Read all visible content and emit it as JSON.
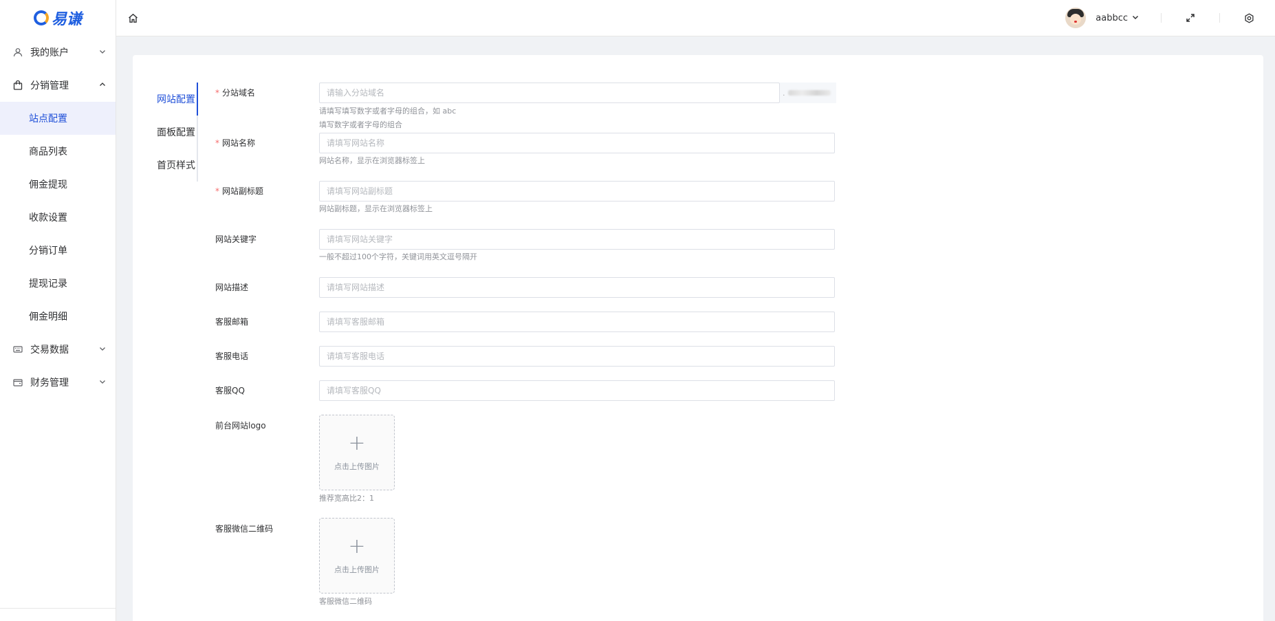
{
  "brand": {
    "name": "易谦"
  },
  "sidebar": {
    "groups": [
      {
        "label": "我的账户",
        "icon": "user-icon",
        "expanded": false
      },
      {
        "label": "分销管理",
        "icon": "bag-icon",
        "expanded": true,
        "items": [
          {
            "label": "站点配置",
            "active": true
          },
          {
            "label": "商品列表"
          },
          {
            "label": "佣金提现"
          },
          {
            "label": "收款设置"
          },
          {
            "label": "分销订单"
          },
          {
            "label": "提现记录"
          },
          {
            "label": "佣金明细"
          }
        ]
      },
      {
        "label": "交易数据",
        "icon": "keyboard-icon",
        "expanded": false
      },
      {
        "label": "财务管理",
        "icon": "wallet-icon",
        "expanded": false
      }
    ]
  },
  "header": {
    "username": "aabbcc"
  },
  "tabs": [
    {
      "label": "网站配置",
      "active": true
    },
    {
      "label": "面板配置"
    },
    {
      "label": "首页样式"
    }
  ],
  "form": {
    "domain": {
      "label": "分站域名",
      "required": true,
      "placeholder": "请输入分站域名",
      "suffix": ".",
      "hint1": "请填写填写数字或者字母的组合，如 abc",
      "hint2": "填写数字或者字母的组合"
    },
    "site_name": {
      "label": "网站名称",
      "required": true,
      "placeholder": "请填写网站名称",
      "hint": "网站名称，显示在浏览器标签上"
    },
    "subtitle": {
      "label": "网站副标题",
      "required": true,
      "placeholder": "请填写网站副标题",
      "hint": "网站副标题，显示在浏览器标签上"
    },
    "keywords": {
      "label": "网站关键字",
      "placeholder": "请填写网站关键字",
      "hint": "一般不超过100个字符，关键词用英文逗号隔开"
    },
    "description": {
      "label": "网站描述",
      "placeholder": "请填写网站描述"
    },
    "email": {
      "label": "客服邮箱",
      "placeholder": "请填写客服邮箱"
    },
    "phone": {
      "label": "客服电话",
      "placeholder": "请填写客服电话"
    },
    "qq": {
      "label": "客服QQ",
      "placeholder": "请填写客服QQ"
    },
    "logo": {
      "label": "前台网站logo",
      "upload_text": "点击上传图片",
      "hint": "推荐宽高比2：1"
    },
    "wechat_qr": {
      "label": "客服微信二维码",
      "upload_text": "点击上传图片",
      "hint": "客服微信二维码"
    }
  }
}
